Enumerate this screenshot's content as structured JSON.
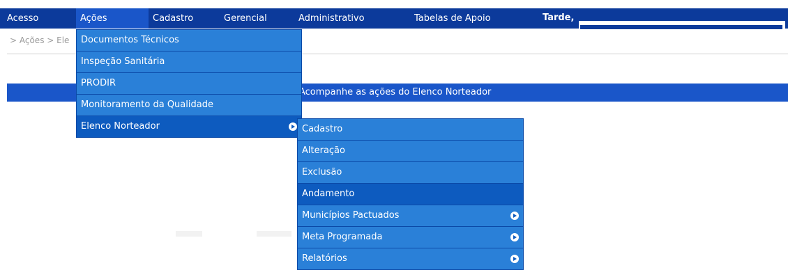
{
  "nav": {
    "items": [
      {
        "label": "Acesso"
      },
      {
        "label": "Ações"
      },
      {
        "label": "Cadastro"
      },
      {
        "label": "Gerencial"
      },
      {
        "label": "Administrativo"
      },
      {
        "label": "Tabelas de Apoio"
      }
    ],
    "greeting": "Tarde,"
  },
  "breadcrumb": "> Ações > Ele",
  "title_bar": "Acompanhe as ações do Elenco Norteador",
  "acoes_menu": [
    {
      "label": "Documentos Técnicos"
    },
    {
      "label": "Inspeção Sanitária"
    },
    {
      "label": "PRODIR"
    },
    {
      "label": "Monitoramento da Qualidade"
    },
    {
      "label": "Elenco Norteador"
    }
  ],
  "elenco_menu": [
    {
      "label": "Cadastro"
    },
    {
      "label": "Alteração"
    },
    {
      "label": "Exclusão"
    },
    {
      "label": "Andamento"
    },
    {
      "label": "Municípios Pactuados"
    },
    {
      "label": "Meta Programada"
    },
    {
      "label": "Relatórios"
    }
  ],
  "colors": {
    "nav_bg": "#0c3a9b",
    "menu_bg": "#2a80d8",
    "menu_selected": "#0d5bbf",
    "title_bar": "#1a56c9"
  }
}
